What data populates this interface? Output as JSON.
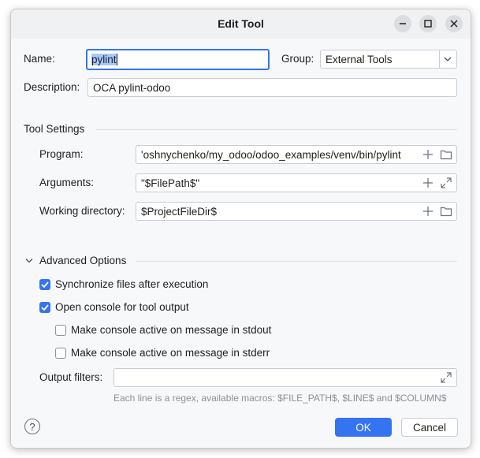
{
  "window": {
    "title": "Edit Tool",
    "minimize_icon": "minimize-icon",
    "maximize_icon": "maximize-icon",
    "close_icon": "close-icon"
  },
  "form": {
    "name_label": "Name:",
    "name_value": "pylint",
    "group_label": "Group:",
    "group_value": "External Tools",
    "description_label": "Description:",
    "description_value": "OCA pylint-odoo"
  },
  "tool_settings": {
    "title": "Tool Settings",
    "program_label": "Program:",
    "program_value": "'oshnychenko/my_odoo/odoo_examples/venv/bin/pylint",
    "arguments_label": "Arguments:",
    "arguments_value": "\"$FilePath$\"",
    "working_dir_label": "Working directory:",
    "working_dir_value": "$ProjectFileDir$"
  },
  "advanced": {
    "title": "Advanced Options",
    "sync_label": "Synchronize files after execution",
    "sync_checked": true,
    "console_label": "Open console for tool output",
    "console_checked": true,
    "stdout_label": "Make console active on message in stdout",
    "stdout_checked": false,
    "stderr_label": "Make console active on message in stderr",
    "stderr_checked": false,
    "output_filters_label": "Output filters:",
    "output_filters_value": "",
    "hint": "Each line is a regex, available macros: $FILE_PATH$, $LINE$ and $COLUMN$"
  },
  "footer": {
    "help_label": "?",
    "ok_label": "OK",
    "cancel_label": "Cancel"
  },
  "colors": {
    "accent": "#3574f0",
    "selection": "#a6c8ff",
    "background": "#f7f8fa"
  }
}
